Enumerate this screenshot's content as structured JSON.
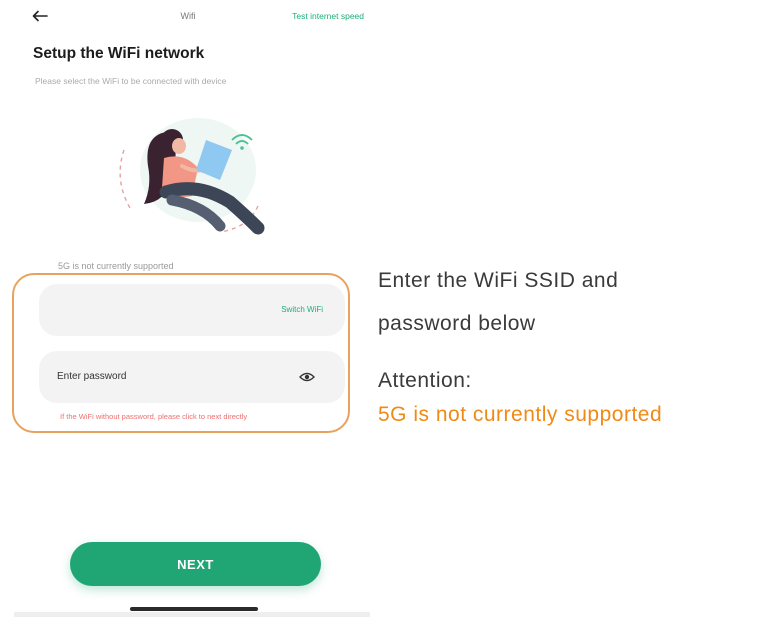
{
  "header": {
    "back_icon": "arrow-left-icon",
    "title": "Wifi",
    "action_label": "Test internet speed"
  },
  "main": {
    "title": "Setup the WiFi network",
    "subtitle": "Please select the WiFi to be connected with device",
    "illustration": "woman-with-laptop-illustration",
    "note_5g": "5G is not currently supported",
    "ssid": {
      "value": "",
      "switch_label": "Switch WiFi"
    },
    "password": {
      "placeholder": "Enter password",
      "eye_icon": "eye-icon"
    },
    "hint": "If the WiFi without password, please click to next directly",
    "next_label": "NEXT"
  },
  "annotation": {
    "line1": "Enter the WiFi SSID and",
    "line2": "password below",
    "line3": "Attention:",
    "line4": "5G is not currently supported"
  },
  "colors": {
    "accent_green": "#1fa674",
    "highlight_orange": "#e9a25e",
    "warning_orange": "#ef8a16",
    "hint_red": "#ee7070"
  }
}
